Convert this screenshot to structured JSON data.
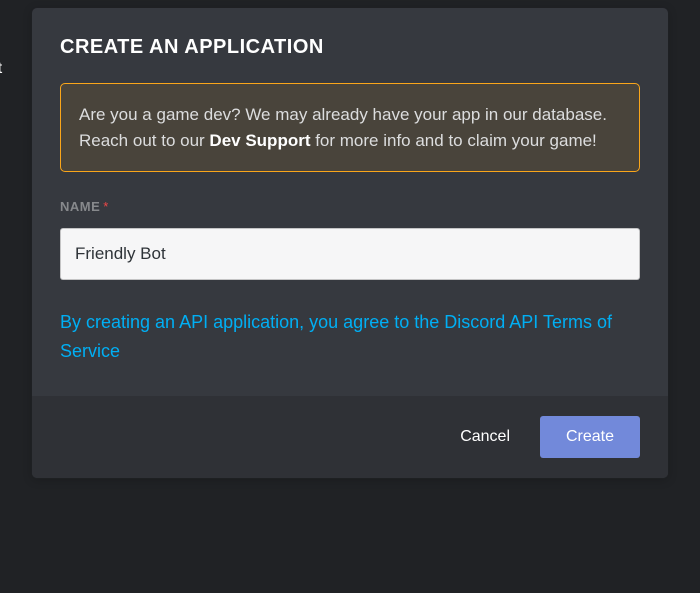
{
  "modal": {
    "title": "CREATE AN APPLICATION",
    "infoBox": {
      "textBefore": "Are you a game dev? We may already have your app in our database. Reach out to our ",
      "boldText": "Dev Support",
      "textAfter": " for more info and to claim your game!"
    },
    "nameField": {
      "label": "NAME",
      "requiredMark": "*",
      "value": "Friendly Bot"
    },
    "tosText": "By creating an API application, you agree to the Discord API Terms of Service",
    "footer": {
      "cancelLabel": "Cancel",
      "createLabel": "Create"
    }
  },
  "colors": {
    "accent": "#7289da",
    "warningBorder": "#faa61a",
    "link": "#00aff4",
    "danger": "#f04747"
  }
}
